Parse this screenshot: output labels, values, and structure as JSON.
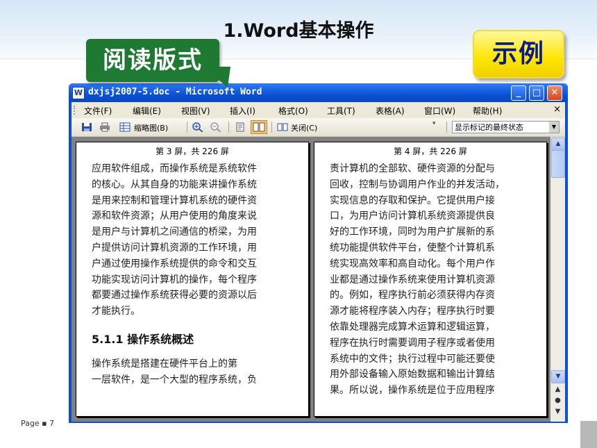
{
  "slide": {
    "title": "1.Word基本操作",
    "callout_label": "阅读版式",
    "example_label": "示例",
    "footer": "Page ▪ 7"
  },
  "window": {
    "title": "dxjsj2007-5.doc - Microsoft Word",
    "icon": "word-doc-icon",
    "controls": {
      "minimize": "_",
      "maximize": "□",
      "close": "✕"
    }
  },
  "menu": {
    "items": [
      "文件(F)",
      "编辑(E)",
      "视图(V)",
      "插入(I)",
      "格式(O)",
      "工具(T)",
      "表格(A)",
      "窗口(W)",
      "帮助(H)"
    ],
    "close": "×"
  },
  "toolbar": {
    "thumbnails_label": "缩略图(B)",
    "close_label": "关闭(C)",
    "markup_state": "显示标记的最终状态",
    "icons": [
      "save-icon",
      "print-icon",
      "thumbnails-icon",
      "zoom-in-icon",
      "zoom-out-icon",
      "document-map-icon",
      "reading-layout-icon",
      "close-book-icon"
    ]
  },
  "pages": [
    {
      "header": "第 3 屏，共 226 屏",
      "lines": [
        "应用软件组成，而操作系统是系统软件",
        "的核心。从其自身的功能来讲操作系统",
        "是用来控制和管理计算机系统的硬件资",
        "源和软件资源；从用户使用的角度来说",
        "是用户与计算机之间通信的桥梁，为用",
        "户提供访问计算机资源的工作环境，用",
        "户通过使用操作系统提供的命令和交互",
        "功能实现访问计算机的操作，每个程序",
        "都要通过操作系统获得必要的资源以后",
        "才能执行。"
      ],
      "section_heading": "5.1.1  操作系统概述",
      "lines2": [
        "    操作系统是搭建在硬件平台上的第",
        "一层软件，是一个大型的程序系统，负"
      ]
    },
    {
      "header": "第 4 屏，共 226 屏",
      "lines": [
        "责计算机的全部软、硬件资源的分配与",
        "回收，控制与协调用户作业的并发活动，",
        "实现信息的存取和保护。它提供用户接",
        "口，为用户访问计算机系统资源提供良",
        "好的工作环境，同时为用户扩展新的系",
        "统功能提供软件平台，使整个计算机系",
        "统实现高效率和高自动化。每个用户作",
        "业都是通过操作系统来使用计算机资源",
        "的。例如，程序执行前必须获得内存资",
        "源才能将程序装入内存；程序执行时要",
        "依靠处理器完成算术运算和逻辑运算，",
        "程序在执行时需要调用子程序或者使用",
        "系统中的文件；执行过程中可能还要使",
        "用外部设备输入原始数据和输出计算结",
        "果。所以说，操作系统是位于应用程序"
      ]
    }
  ]
}
